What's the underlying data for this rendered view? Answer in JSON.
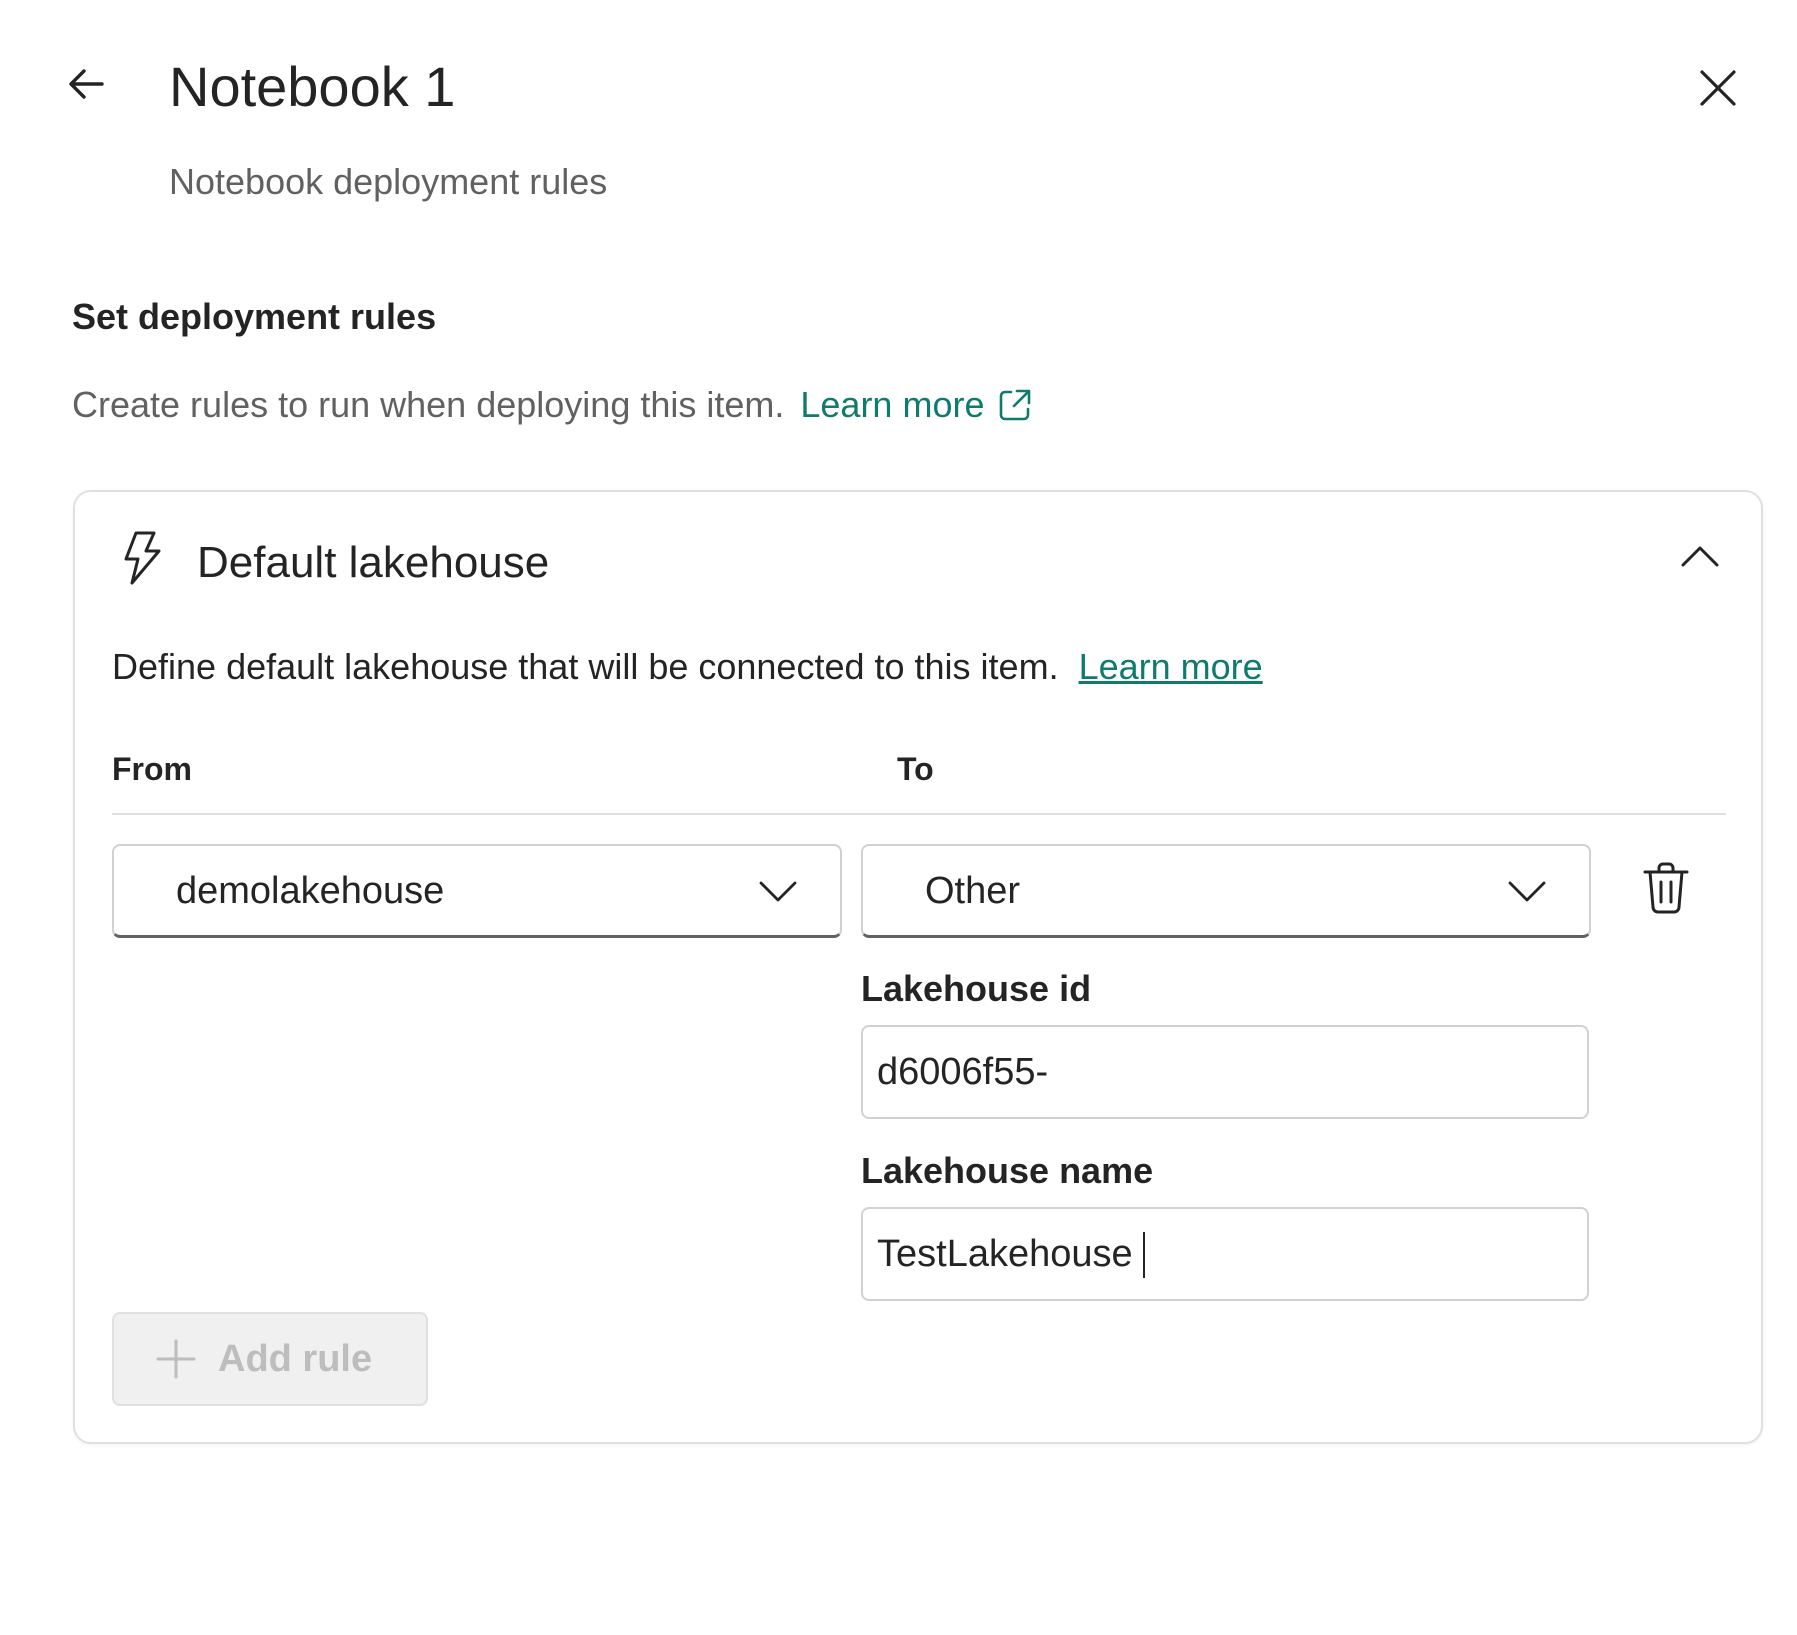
{
  "header": {
    "title": "Notebook 1",
    "subtitle": "Notebook deployment rules",
    "back_icon": "arrow-left-icon",
    "close_icon": "close-icon"
  },
  "section": {
    "heading": "Set deployment rules",
    "description": "Create rules to run when deploying this item.",
    "learn_more": "Learn more",
    "external_icon": "open-external-icon"
  },
  "card": {
    "icon": "lightning-icon",
    "title": "Default lakehouse",
    "collapse_icon": "chevron-up-icon",
    "description": "Define default lakehouse that will be connected to this item.",
    "learn_more": "Learn more",
    "columns": {
      "from": "From",
      "to": "To"
    },
    "rule": {
      "from_value": "demolakehouse",
      "to_value": "Other",
      "delete_icon": "trash-icon",
      "lakehouse_id_label": "Lakehouse id",
      "lakehouse_id_value": "d6006f55-",
      "lakehouse_name_label": "Lakehouse name",
      "lakehouse_name_value": "TestLakehouse"
    },
    "add_rule_label": "Add rule",
    "add_rule_state": "disabled"
  },
  "colors": {
    "accent_link": "#0f7b6c",
    "text_primary": "#242424",
    "text_secondary": "#616161",
    "disabled_text": "#bdbdbd",
    "disabled_bg": "#f0f0f0"
  }
}
